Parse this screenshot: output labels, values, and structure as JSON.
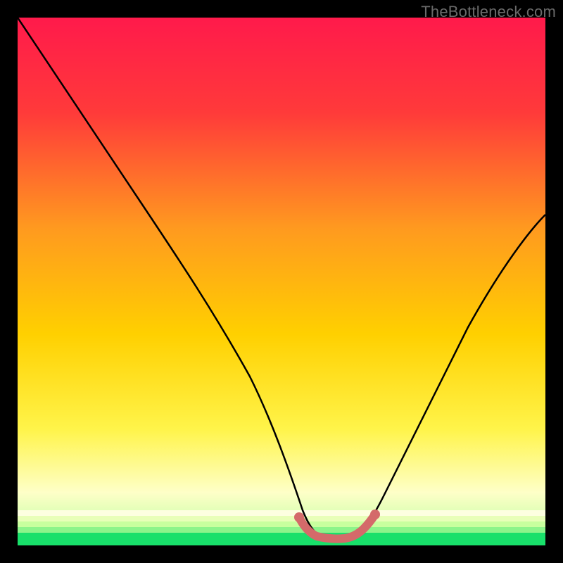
{
  "watermark": "TheBottleneck.com",
  "colors": {
    "bg": "#000000",
    "gradient_top": "#ff1a4b",
    "gradient_mid_upper": "#ff6a2a",
    "gradient_mid": "#ffcc00",
    "gradient_mid_lower": "#fff833",
    "gradient_low": "#fdffb0",
    "green": "#18e06a",
    "curve": "#000000",
    "marker": "#d46a6a"
  },
  "chart_data": {
    "type": "line",
    "title": "",
    "xlabel": "",
    "ylabel": "",
    "xlim": [
      0,
      100
    ],
    "ylim": [
      0,
      100
    ],
    "series": [
      {
        "name": "bottleneck-curve",
        "x": [
          0,
          5,
          10,
          15,
          20,
          25,
          30,
          35,
          40,
          45,
          48,
          50,
          52,
          55,
          58,
          60,
          62,
          65,
          70,
          75,
          80,
          85,
          90,
          95,
          100
        ],
        "y": [
          100,
          92,
          83,
          74,
          65,
          56,
          47,
          38,
          29,
          19,
          10,
          4,
          1,
          0,
          0,
          1,
          3,
          6,
          12,
          20,
          29,
          38,
          47,
          55,
          62
        ]
      }
    ],
    "annotations": [
      {
        "name": "flat-bottom-marker",
        "x": [
          50,
          51,
          52,
          53,
          54,
          55,
          56,
          57,
          58,
          59,
          60,
          61,
          62
        ],
        "y": [
          2.5,
          2.0,
          1.6,
          1.3,
          1.1,
          1.0,
          1.0,
          1.1,
          1.4,
          1.8,
          2.4,
          3.1,
          4.0
        ],
        "color": "#d46a6a",
        "style": "dots+line"
      }
    ]
  }
}
